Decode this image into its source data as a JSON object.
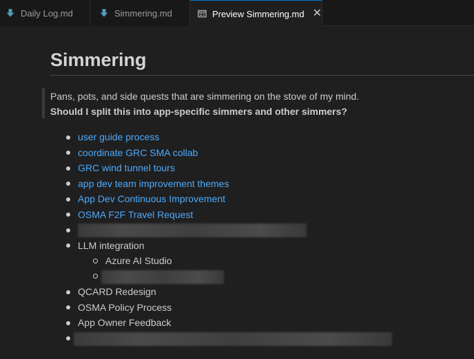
{
  "tabs": [
    {
      "label": "Daily Log.md",
      "icon": "markdown-arrow-icon",
      "active": false
    },
    {
      "label": "Simmering.md",
      "icon": "markdown-arrow-icon",
      "active": false
    },
    {
      "label": "Preview Simmering.md",
      "icon": "preview-icon",
      "active": true
    }
  ],
  "document": {
    "title": "Simmering",
    "quote_line1": "Pans, pots, and side quests that are simmering on the stove of my mind.",
    "quote_line2": "Should I split this into app-specific simmers and other simmers?",
    "items": [
      {
        "label": "user guide process",
        "link": true
      },
      {
        "label": "coordinate GRC SMA collab",
        "link": true
      },
      {
        "label": "GRC wind tunnel tours",
        "link": true
      },
      {
        "label": "app dev team improvement themes",
        "link": true
      },
      {
        "label": "App Dev Continuous Improvement",
        "link": true
      },
      {
        "label": "OSMA F2F Travel Request",
        "link": true
      },
      {
        "label": "LLM integration",
        "link": false
      },
      {
        "label": "QCARD Redesign",
        "link": false
      },
      {
        "label": "OSMA Policy Process",
        "link": false
      },
      {
        "label": "App Owner Feedback",
        "link": false
      }
    ],
    "subitems": [
      {
        "label": "Azure AI Studio"
      }
    ]
  },
  "colors": {
    "link": "#4daafc",
    "text": "#cccccc",
    "accent": "#0078d4",
    "background": "#1f1f1f"
  }
}
